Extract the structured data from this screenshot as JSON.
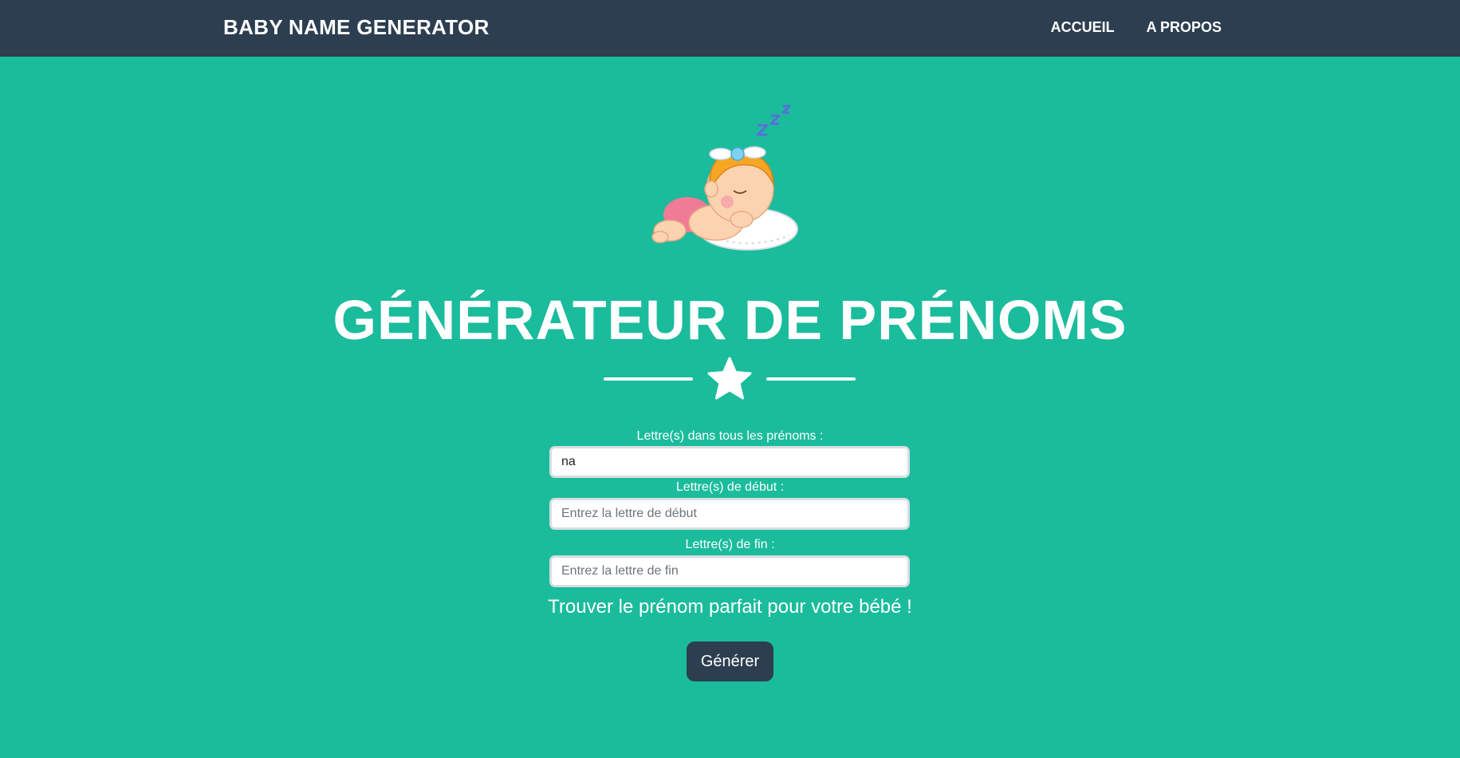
{
  "header": {
    "brand": "BABY NAME GENERATOR",
    "nav": [
      {
        "label": "ACCUEIL"
      },
      {
        "label": "A PROPOS"
      }
    ]
  },
  "hero": {
    "illustration_icon": "sleeping-baby-icon",
    "illustration_zzz": "Z Z Z",
    "title": "GÉNÉRATEUR DE PRÉNOMS",
    "divider_icon": "star-icon"
  },
  "form": {
    "contains": {
      "label": "Lettre(s) dans tous les prénoms :",
      "value": "na",
      "placeholder": ""
    },
    "start": {
      "label": "Lettre(s) de début :",
      "value": "",
      "placeholder": "Entrez la lettre de début"
    },
    "end": {
      "label": "Lettre(s) de fin :",
      "value": "",
      "placeholder": "Entrez la lettre de fin"
    },
    "tagline": "Trouver le prénom parfait pour votre bébé !",
    "submit_label": "Générer"
  },
  "colors": {
    "background": "#1abc9c",
    "navbar": "#2c3e50",
    "button": "#2c3e50",
    "text": "#ffffff"
  }
}
